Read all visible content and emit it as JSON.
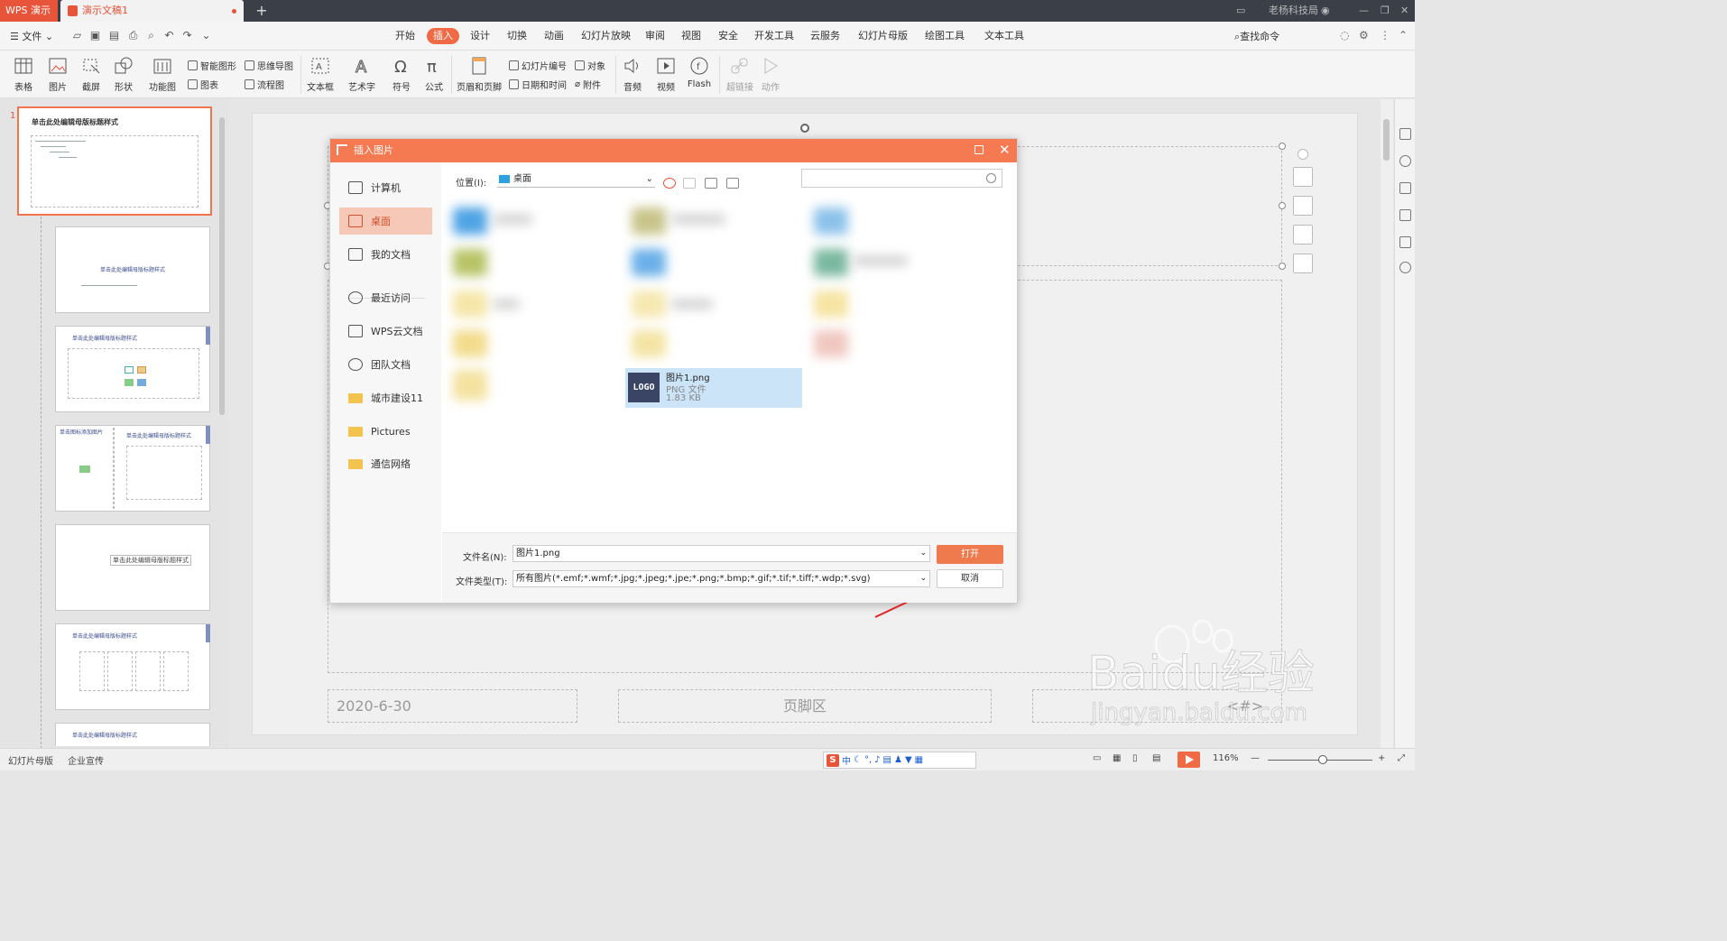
{
  "titlebar": {
    "app_tab": "WPS 演示",
    "doc_tab": "演示文稿1",
    "user": "老杨科技局"
  },
  "menubar": {
    "file": "文件",
    "tabs": [
      "开始",
      "插入",
      "设计",
      "切换",
      "动画",
      "幻灯片放映",
      "审阅",
      "视图",
      "安全",
      "开发工具",
      "云服务",
      "幻灯片母版",
      "绘图工具",
      "文本工具"
    ],
    "active_tab": "插入",
    "search": "查找命令"
  },
  "ribbon": {
    "table": "表格",
    "picture": "图片",
    "screenshot": "截屏",
    "shape": "形状",
    "function_chart": "功能图",
    "smart_shape": "智能图形",
    "mindmap": "思维导图",
    "chart": "图表",
    "flowchart": "流程图",
    "textbox": "文本框",
    "art_text": "艺术字",
    "symbol": "符号",
    "formula": "公式",
    "header_footer": "页眉和页脚",
    "slide_number": "幻灯片编号",
    "object": "对象",
    "datetime": "日期和时间",
    "attachment": "附件",
    "audio": "音频",
    "video": "视频",
    "flash": "Flash",
    "hyperlink": "超链接",
    "action": "动作"
  },
  "thumbnails": {
    "index": "1",
    "t1": "单击此处编辑母版标题样式",
    "t2": "单击此处编辑母版标题样式",
    "t3": "单击此处编辑母版标题样式",
    "t4a": "单击图标添加图片",
    "t4b": "单击此处编辑母版标题样式",
    "t5": "单击此处编辑母版标题样式",
    "t6": "单击此处编辑母版标题样式",
    "t7": "单击此处编辑母版标题样式"
  },
  "slide": {
    "date": "2020-6-30",
    "footer": "页脚区",
    "number": "<#>"
  },
  "dialog": {
    "title": "插入图片",
    "nav": [
      "计算机",
      "桌面",
      "我的文档",
      "最近访问",
      "WPS云文档",
      "团队文档",
      "城市建设11",
      "Pictures",
      "通信网络"
    ],
    "active_nav": "桌面",
    "location_label": "位置(I):",
    "location": "桌面",
    "file": {
      "name": "图片1.png",
      "type": "PNG 文件",
      "size": "1.83 KB",
      "logo": "LOGO"
    },
    "filename_label": "文件名(N):",
    "filename_value": "图片1.png",
    "filetype_label": "文件类型(T):",
    "filetype_value": "所有图片(*.emf;*.wmf;*.jpg;*.jpeg;*.jpe;*.png;*.bmp;*.gif;*.tif;*.tiff;*.wdp;*.svg)",
    "open": "打开",
    "cancel": "取消"
  },
  "statusbar": {
    "mode": "幻灯片母版",
    "theme": "企业宣传",
    "zoom": "116%",
    "ime": "中"
  },
  "watermark": {
    "brand": "Baidu经验",
    "url": "jingyan.baidu.com"
  },
  "colors": {
    "accent": "#ef6a45",
    "selection": "#cce4f7",
    "titlebar": "#3b3f48"
  }
}
